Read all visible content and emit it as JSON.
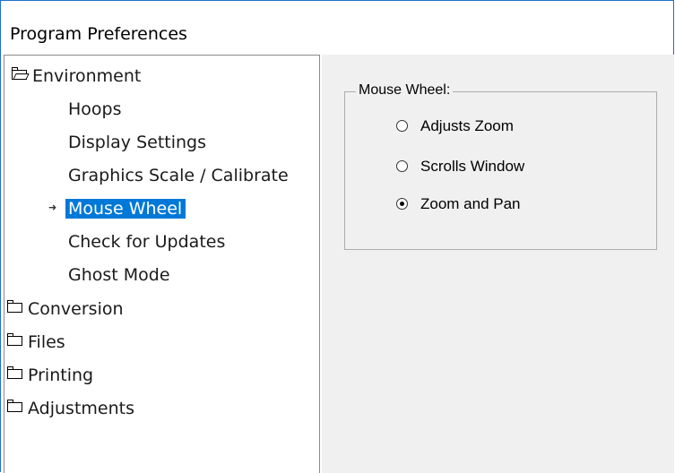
{
  "window": {
    "title": "Program Preferences"
  },
  "tree": {
    "items": [
      {
        "label": "Environment",
        "icon": "folder-open-icon",
        "level": 0
      },
      {
        "label": "Hoops",
        "level": 1
      },
      {
        "label": "Display Settings",
        "level": 1
      },
      {
        "label": "Graphics Scale / Calibrate",
        "level": 1
      },
      {
        "label": "Mouse Wheel",
        "level": 1,
        "selected": true
      },
      {
        "label": "Check for Updates",
        "level": 1
      },
      {
        "label": "Ghost Mode",
        "level": 1
      },
      {
        "label": "Conversion",
        "icon": "folder-icon",
        "level": 0
      },
      {
        "label": "Files",
        "icon": "folder-icon",
        "level": 0
      },
      {
        "label": "Printing",
        "icon": "folder-icon",
        "level": 0
      },
      {
        "label": "Adjustments",
        "icon": "folder-icon",
        "level": 0
      }
    ]
  },
  "mouse_wheel": {
    "group_label": "Mouse Wheel:",
    "options": [
      {
        "label": "Adjusts Zoom",
        "checked": false
      },
      {
        "label": "Scrolls Window",
        "checked": false
      },
      {
        "label": "Zoom and Pan",
        "checked": true
      }
    ]
  },
  "colors": {
    "selection": "#0078d7",
    "window_border": "#1e6fd0",
    "panel_bg": "#f0f0f0"
  }
}
